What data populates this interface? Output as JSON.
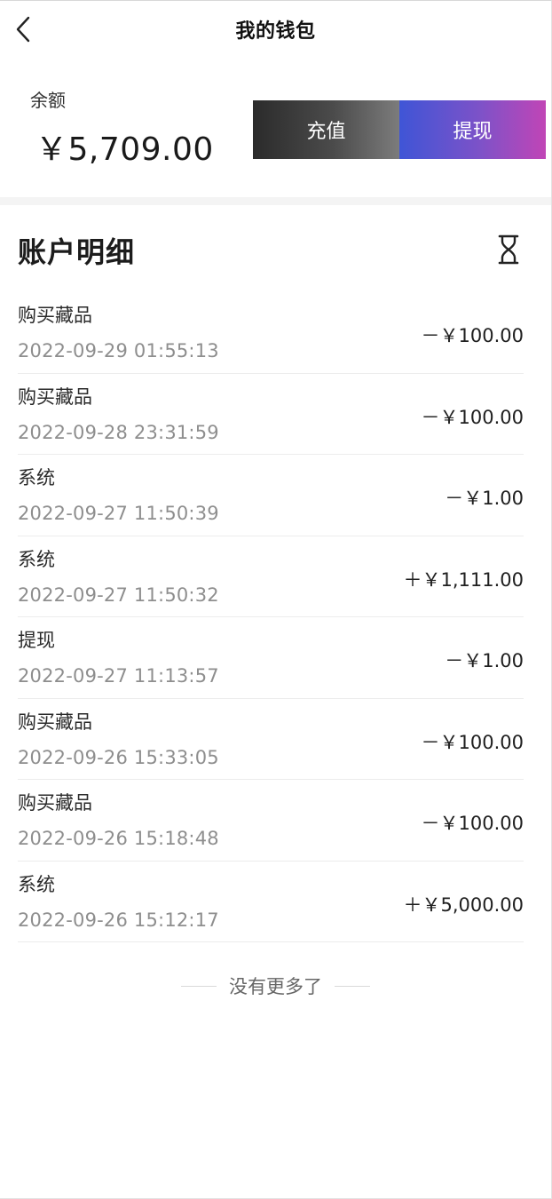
{
  "header": {
    "title": "我的钱包"
  },
  "balance": {
    "label": "余额",
    "amount": "￥5,709.00"
  },
  "actions": {
    "recharge_label": "充值",
    "withdraw_label": "提现"
  },
  "details": {
    "title": "账户明细",
    "filter_icon": "hourglass-icon"
  },
  "transactions": [
    {
      "type": "购买藏品",
      "time": "2022-09-29 01:55:13",
      "amount": "－￥100.00"
    },
    {
      "type": "购买藏品",
      "time": "2022-09-28 23:31:59",
      "amount": "－￥100.00"
    },
    {
      "type": "系统",
      "time": "2022-09-27 11:50:39",
      "amount": "－￥1.00"
    },
    {
      "type": "系统",
      "time": "2022-09-27 11:50:32",
      "amount": "＋￥1,111.00"
    },
    {
      "type": "提现",
      "time": "2022-09-27 11:13:57",
      "amount": "－￥1.00"
    },
    {
      "type": "购买藏品",
      "time": "2022-09-26 15:33:05",
      "amount": "－￥100.00"
    },
    {
      "type": "购买藏品",
      "time": "2022-09-26 15:18:48",
      "amount": "－￥100.00"
    },
    {
      "type": "系统",
      "time": "2022-09-26 15:12:17",
      "amount": "＋￥5,000.00"
    }
  ],
  "footer": {
    "end_text": "没有更多了"
  },
  "colors": {
    "withdraw_gradient_start": "#3f55d6",
    "withdraw_gradient_end": "#c145b6",
    "recharge_gradient_start": "#2b2b2b",
    "recharge_gradient_end": "#7c7c7c"
  }
}
